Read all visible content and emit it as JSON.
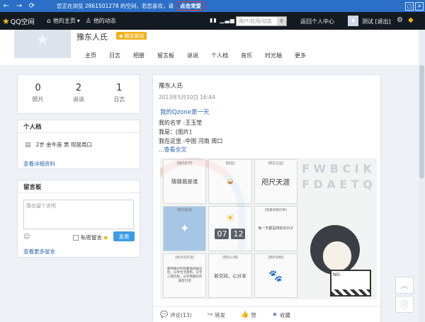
{
  "browser_bar": {
    "back_icon": "←",
    "forward_icon": "→",
    "refresh_icon": "⟳",
    "notice": "您正在浏览 2861501278 的空间，若您喜欢，请",
    "notice_link": "点击宠爱",
    "min_icon": "▢",
    "close_icon": "✕"
  },
  "qzone_nav": {
    "logo": "QQ空间",
    "my_home": "他的主页",
    "my_home_arrow": "▾",
    "my_feeds": "他的动态",
    "search_placeholder": "用户/应用/动态",
    "search_icon": "⚲",
    "back_home": "返回个人中心",
    "user": "测试",
    "logout": "[退出]",
    "settings_icon": "⚙",
    "vip_icon": "◆"
  },
  "header": {
    "site_name": "豫东人氏",
    "vip_label": "赠送黄钻",
    "tabs": [
      "主页",
      "日志",
      "相册",
      "留言板",
      "说说",
      "个人档",
      "音乐",
      "时光轴",
      "更多"
    ]
  },
  "stats": [
    {
      "num": "0",
      "label": "照片"
    },
    {
      "num": "2",
      "label": "说说"
    },
    {
      "num": "1",
      "label": "日志"
    }
  ],
  "profile": {
    "title": "个人档",
    "info": "2岁  金牛座  男  现居周口",
    "more": "查看详细资料"
  },
  "board": {
    "title": "留言板",
    "placeholder": "我也留个言吧",
    "private": "私密留言",
    "send": "发表",
    "more": "查看更多留言"
  },
  "post": {
    "author": "豫东人氏",
    "time": "2013年5月10日 16:44",
    "title": "我的Qzone第一天",
    "lines": [
      "我的名字 :王玉莹",
      "我是：[图片]",
      "我在这里 :中国 河南 周口"
    ],
    "ellipsis": "...",
    "read_more": "查看全文",
    "pic": {
      "cells": [
        {
          "tag": "【我的名字】",
          "text": "猜猜我是谁"
        },
        {
          "tag": "【我是】",
          "text": ""
        },
        {
          "tag": "【我在这里】",
          "text": "咫尺天涯"
        },
        {
          "tag": "【我的最爱】",
          "text": ""
        },
        {
          "tag": "",
          "text": "",
          "month": "07",
          "day": "12"
        },
        {
          "tag": "【我最想做的事】",
          "text": "每一天都是特别的日子"
        },
        {
          "tag": "【想对说的话】",
          "text": "最特殊的时刻都值得被记住，分享生活感悟，分享心情历程，分享我最好的朋友们吧"
        },
        {
          "tag": "【我的心情】",
          "text": "新空间，心分享"
        },
        {
          "tag": "【我的宠物】",
          "text": ""
        }
      ],
      "letters": "F W B C I K F D A E T Q",
      "clapper": "NG"
    },
    "actions": [
      {
        "icon": "💬",
        "label": "评论(13)"
      },
      {
        "icon": "↪",
        "label": "转发"
      },
      {
        "icon": "👍",
        "label": "赞"
      },
      {
        "icon": "★",
        "label": "收藏"
      }
    ]
  },
  "float_buttons": {
    "top_icon": "︿",
    "feedback_icon": "ⓘ"
  }
}
